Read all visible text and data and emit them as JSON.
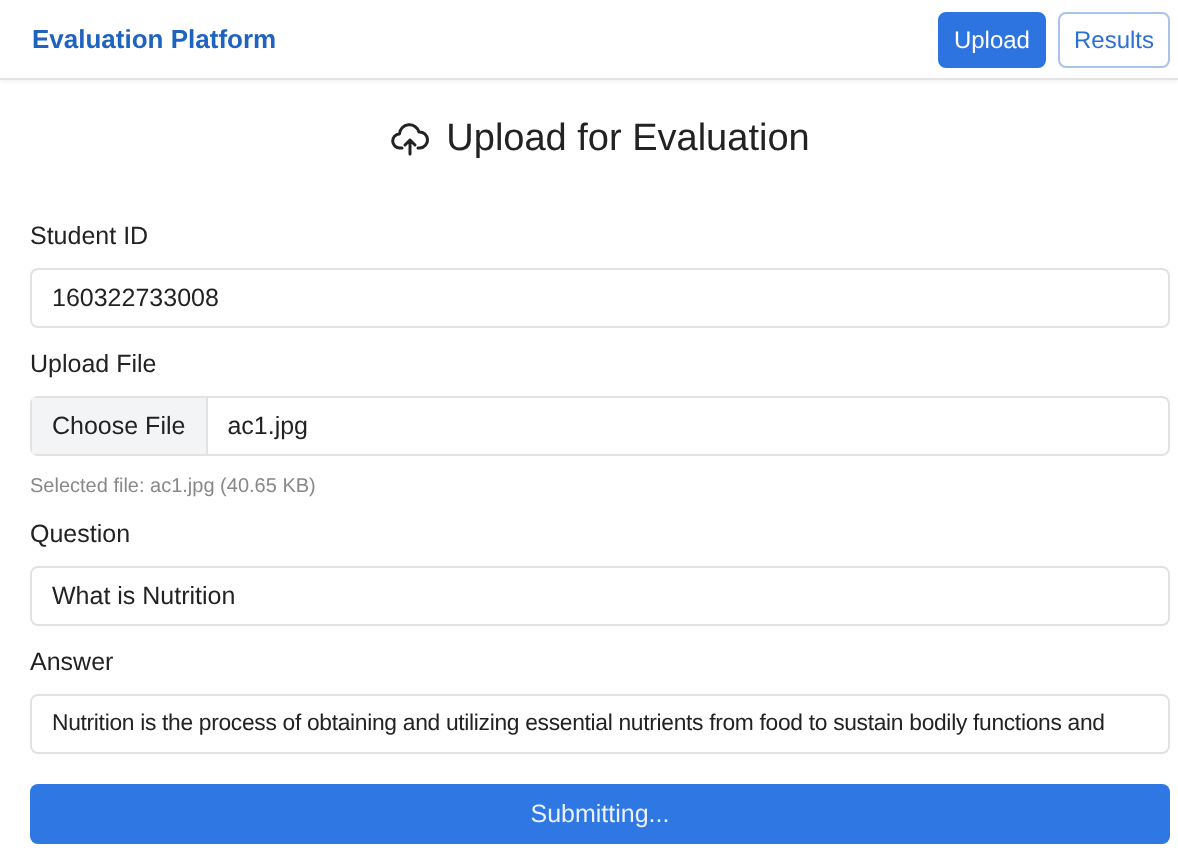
{
  "navbar": {
    "brand": "Evaluation Platform",
    "nav": [
      {
        "label": "Upload",
        "selected": true
      },
      {
        "label": "Results",
        "selected": false
      }
    ]
  },
  "heading": "Upload for Evaluation",
  "form": {
    "fields": [
      {
        "kind": "text",
        "label": "Student ID",
        "value": "160322733008"
      },
      {
        "kind": "file",
        "label": "Upload File",
        "button": "Choose File",
        "value": "ac1.jpg",
        "help": "Selected file: ac1.jpg (40.65 KB)"
      },
      {
        "kind": "text",
        "label": "Question",
        "value": "What is Nutrition"
      },
      {
        "kind": "text",
        "label": "Answer",
        "value": "Nutrition is the process of obtaining and utilizing essential nutrients from food to sustain bodily functions and"
      }
    ],
    "submit": "Submitting..."
  }
}
